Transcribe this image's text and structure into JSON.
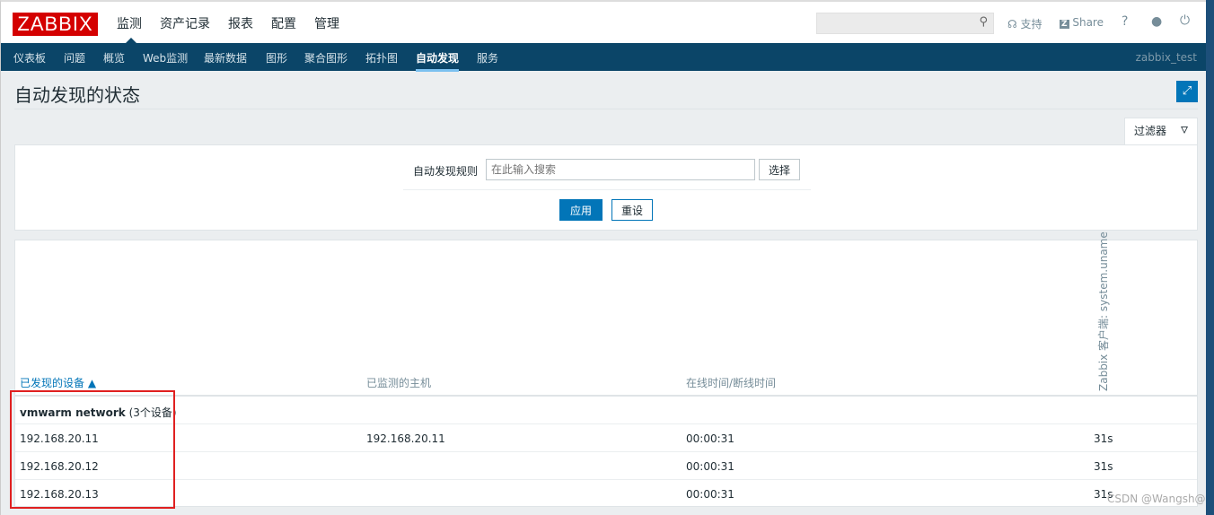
{
  "header": {
    "logo": "ZABBIX",
    "main_menu": [
      "监测",
      "资产记录",
      "报表",
      "配置",
      "管理"
    ],
    "search_placeholder": "",
    "support": "支持",
    "share": "Share",
    "help": "?"
  },
  "nav": {
    "items": [
      "仪表板",
      "问题",
      "概览",
      "Web监测",
      "最新数据",
      "图形",
      "聚合图形",
      "拓扑图",
      "自动发现",
      "服务"
    ],
    "active": "自动发现",
    "user": "zabbix_test"
  },
  "page": {
    "title": "自动发现的状态"
  },
  "filter": {
    "tab": "过滤器",
    "rule_label": "自动发现规则",
    "rule_placeholder": "在此输入搜索",
    "select": "选择",
    "apply": "应用",
    "reset": "重设"
  },
  "table": {
    "columns": [
      "已发现的设备 ▲",
      "已监测的主机",
      "在线时间/断线时间",
      "Zabbix 客户端: system.uname"
    ],
    "group": {
      "name": "vmwarm network",
      "count": "(3个设备)"
    },
    "rows": [
      [
        "192.168.20.11",
        "192.168.20.11",
        "00:00:31",
        "31s"
      ],
      [
        "192.168.20.12",
        "",
        "00:00:31",
        "31s"
      ],
      [
        "192.168.20.13",
        "",
        "00:00:31",
        "31s"
      ]
    ]
  },
  "watermark": "CSDN @Wangsh@"
}
